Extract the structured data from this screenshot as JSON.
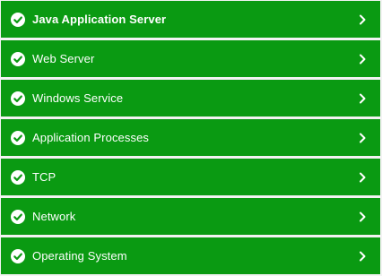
{
  "colors": {
    "row_bg": "#0a9a12",
    "text": "#ffffff",
    "separator": "#f3f3f3"
  },
  "items": [
    {
      "label": "Java Application Server",
      "status_icon": "check-circle-icon",
      "nav_icon": "chevron-right-icon",
      "emphasis": "bold"
    },
    {
      "label": "Web Server",
      "status_icon": "check-circle-icon",
      "nav_icon": "chevron-right-icon",
      "emphasis": "normal"
    },
    {
      "label": "Windows Service",
      "status_icon": "check-circle-icon",
      "nav_icon": "chevron-right-icon",
      "emphasis": "normal"
    },
    {
      "label": "Application Processes",
      "status_icon": "check-circle-icon",
      "nav_icon": "chevron-right-icon",
      "emphasis": "normal"
    },
    {
      "label": "TCP",
      "status_icon": "check-circle-icon",
      "nav_icon": "chevron-right-icon",
      "emphasis": "normal"
    },
    {
      "label": "Network",
      "status_icon": "check-circle-icon",
      "nav_icon": "chevron-right-icon",
      "emphasis": "normal"
    },
    {
      "label": "Operating System",
      "status_icon": "check-circle-icon",
      "nav_icon": "chevron-right-icon",
      "emphasis": "normal"
    }
  ]
}
